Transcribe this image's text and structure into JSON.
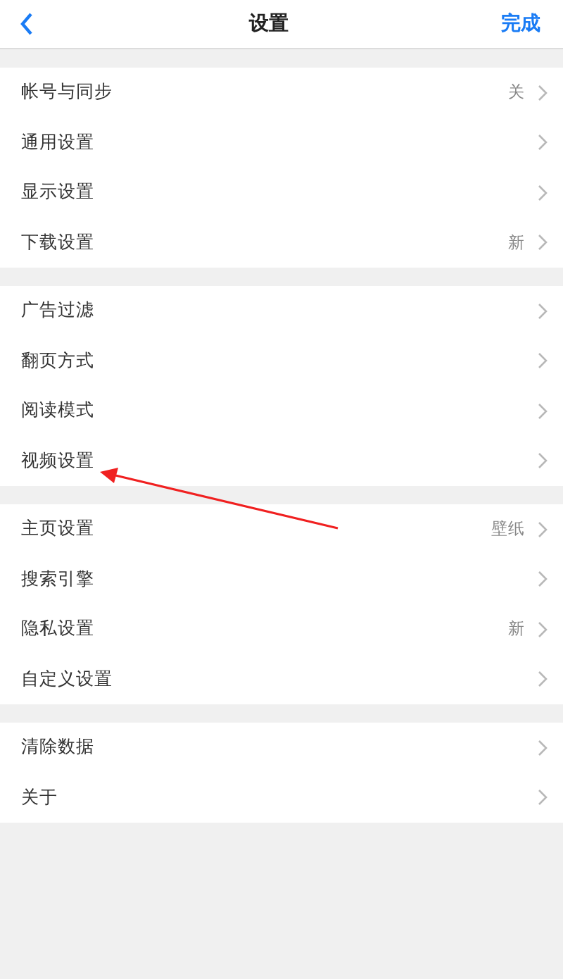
{
  "header": {
    "title": "设置",
    "done": "完成"
  },
  "sections": [
    {
      "items": [
        {
          "label": "帐号与同步",
          "value": "关"
        },
        {
          "label": "通用设置"
        },
        {
          "label": "显示设置"
        },
        {
          "label": "下载设置",
          "value": "新"
        }
      ]
    },
    {
      "items": [
        {
          "label": "广告过滤"
        },
        {
          "label": "翻页方式"
        },
        {
          "label": "阅读模式"
        },
        {
          "label": "视频设置"
        }
      ]
    },
    {
      "items": [
        {
          "label": "主页设置",
          "value": "壁纸"
        },
        {
          "label": "搜索引擎"
        },
        {
          "label": "隐私设置",
          "value": "新"
        },
        {
          "label": "自定义设置"
        }
      ]
    },
    {
      "items": [
        {
          "label": "清除数据"
        },
        {
          "label": "关于"
        }
      ]
    }
  ]
}
